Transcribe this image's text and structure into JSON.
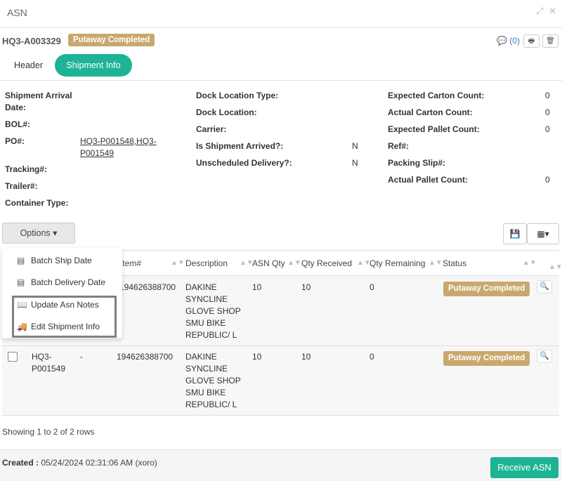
{
  "window": {
    "title": "ASN",
    "expand_icon": "expand-icon",
    "close_icon": "close-icon"
  },
  "asn": {
    "id": "HQ3-A003329",
    "status": "Putaway Completed",
    "comment_count": "(0)"
  },
  "tabs": [
    {
      "label": "Header"
    },
    {
      "label": "Shipment Info"
    }
  ],
  "fields": {
    "shipment_arrival_date": {
      "label_l1": "Shipment Arrival",
      "label_l2": "Date:"
    },
    "bol": {
      "label": "BOL#:"
    },
    "po": {
      "label": "PO#:",
      "value_l1": "HQ3-P001548,HQ3-",
      "value_l2": "P001549"
    },
    "tracking": {
      "label": "Tracking#:"
    },
    "trailer": {
      "label": "Trailer#:"
    },
    "container_type": {
      "label": "Container Type:"
    },
    "dock_location_type": {
      "label": "Dock Location Type:"
    },
    "dock_location": {
      "label": "Dock Location:"
    },
    "carrier": {
      "label": "Carrier:"
    },
    "is_shipment_arrived": {
      "label": "Is Shipment Arrived?:",
      "value": "N"
    },
    "unscheduled_delivery": {
      "label": "Unscheduled Delivery?:",
      "value": "N"
    },
    "expected_carton_count": {
      "label": "Expected Carton Count:",
      "value": "0"
    },
    "actual_carton_count": {
      "label": "Actual Carton Count:",
      "value": "0"
    },
    "expected_pallet_count": {
      "label": "Expected Pallet Count:",
      "value": "0"
    },
    "ref": {
      "label": "Ref#:"
    },
    "packing_slip": {
      "label": "Packing Slip#:"
    },
    "actual_pallet_count": {
      "label": "Actual Pallet Count:",
      "value": "0"
    }
  },
  "toolbar": {
    "options_label": "Options ▾",
    "save_icon": "save-icon",
    "columns_icon": "columns-icon"
  },
  "options_menu": [
    {
      "label": "Batch Ship Date",
      "icon": "list-icon"
    },
    {
      "label": "Batch Delivery Date",
      "icon": "list-icon"
    },
    {
      "label": "Update Asn Notes",
      "icon": "book-icon"
    },
    {
      "label": "Edit Shipment Info",
      "icon": "truck-icon"
    }
  ],
  "table": {
    "columns": {
      "item": "Item#",
      "description": "Description",
      "asn_qty": "ASN Qty",
      "qty_received": "Qty Received",
      "qty_remaining": "Qty Remaining",
      "status": "Status"
    },
    "rows": [
      {
        "po_l1": "",
        "po_l2": "",
        "dash": "",
        "item": "194626388700",
        "desc_l1": "DAKINE",
        "desc_l2": "SYNCLINE",
        "desc_l3": "GLOVE SHOP",
        "desc_l4": "SMU BIKE",
        "desc_l5": "REPUBLIC/ L",
        "asn_qty": "10",
        "qty_received": "10",
        "qty_remaining": "0",
        "status": "Putaway Completed"
      },
      {
        "po_l1": "HQ3-",
        "po_l2": "P001549",
        "dash": "-",
        "item": "194626388700",
        "desc_l1": "DAKINE",
        "desc_l2": "SYNCLINE",
        "desc_l3": "GLOVE SHOP",
        "desc_l4": "SMU BIKE",
        "desc_l5": "REPUBLIC/ L",
        "asn_qty": "10",
        "qty_received": "10",
        "qty_remaining": "0",
        "status": "Putaway Completed"
      }
    ]
  },
  "pagination": {
    "text": "Showing 1 to 2 of 2 rows"
  },
  "footer": {
    "created_label": "Created :",
    "created_value": "05/24/2024 02:31:06 AM (xoro)",
    "receive_button": "Receive ASN"
  }
}
